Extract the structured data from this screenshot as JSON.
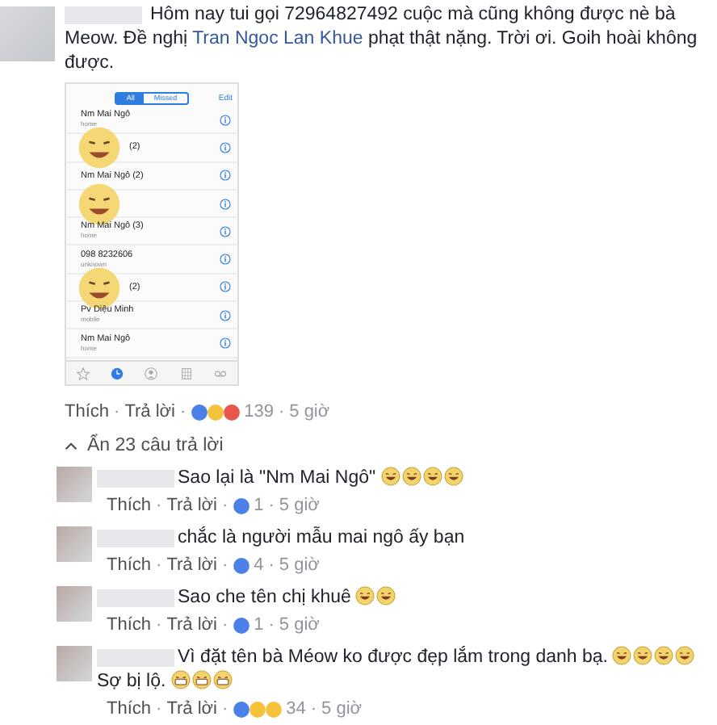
{
  "comment": {
    "text_before": "Hôm nay tui gọi 72964827492 cuộc mà cũng không được nè bà Meow. Đề nghị ",
    "link": "Tran Ngoc Lan Khue",
    "text_after": " phạt thật nặng. Trời ơi. Goih hoài không được.",
    "screenshot": {
      "tabs": [
        {
          "label": "All",
          "selected": true
        },
        {
          "label": "Missed",
          "selected": false
        }
      ],
      "edit": "Edit",
      "calls": [
        {
          "name": "Nm Mai Ngô",
          "sub": "home",
          "covered": false
        },
        {
          "name": "(2)",
          "covered": true
        },
        {
          "name": "Nm Mai Ngô (2)",
          "covered": false
        },
        {
          "covered": true
        },
        {
          "name": "Nm Mai Ngô (3)",
          "sub": "home",
          "covered": false
        },
        {
          "name": "098 8232606",
          "sub": "unknown",
          "covered": false
        },
        {
          "name": "(2)",
          "covered": true
        },
        {
          "name": "Pv Diệu Minh",
          "sub": "mobile",
          "covered": false
        },
        {
          "name": "Nm Mai Ngô",
          "sub": "home",
          "covered": false
        }
      ]
    },
    "actions": [
      {
        "kind": "like",
        "text": "Thích"
      },
      {
        "kind": "sep",
        "text": "·"
      },
      {
        "kind": "reply",
        "text": "Trả lời"
      },
      {
        "kind": "sep",
        "text": "·"
      },
      {
        "kind": "reactions",
        "reactions": [
          {
            "kind": "like"
          },
          {
            "kind": "haha"
          },
          {
            "kind": "angry"
          }
        ]
      },
      {
        "kind": "count",
        "text": "139"
      },
      {
        "kind": "sep",
        "text": "·"
      },
      {
        "kind": "time",
        "text": "5 giờ"
      }
    ]
  },
  "toggle": "Ẩn 23 câu trả lời",
  "replies": [
    {
      "parts": [
        {
          "kind": "text",
          "text": "Sao lại là \"Nm Mai Ngô\""
        },
        {
          "kind": "laugh"
        },
        {
          "kind": "laugh"
        },
        {
          "kind": "laugh"
        },
        {
          "kind": "laugh"
        }
      ],
      "actions": [
        {
          "kind": "like",
          "text": "Thích"
        },
        {
          "kind": "sep",
          "text": "·"
        },
        {
          "kind": "reply",
          "text": "Trả lời"
        },
        {
          "kind": "sep",
          "text": "·"
        },
        {
          "kind": "reactions",
          "reactions": [
            {
              "kind": "like"
            }
          ]
        },
        {
          "kind": "count",
          "text": "1"
        },
        {
          "kind": "sep",
          "text": "·"
        },
        {
          "kind": "time",
          "text": "5 giờ"
        }
      ]
    },
    {
      "parts": [
        {
          "kind": "text",
          "text": "chắc là người mẫu mai ngô ấy bạn"
        }
      ],
      "actions": [
        {
          "kind": "like",
          "text": "Thích"
        },
        {
          "kind": "sep",
          "text": "·"
        },
        {
          "kind": "reply",
          "text": "Trả lời"
        },
        {
          "kind": "sep",
          "text": "·"
        },
        {
          "kind": "reactions",
          "reactions": [
            {
              "kind": "like"
            }
          ]
        },
        {
          "kind": "count",
          "text": "4"
        },
        {
          "kind": "sep",
          "text": "·"
        },
        {
          "kind": "time",
          "text": "5 giờ"
        }
      ]
    },
    {
      "parts": [
        {
          "kind": "text",
          "text": "Sao che tên chị khuê"
        },
        {
          "kind": "laugh"
        },
        {
          "kind": "laugh"
        }
      ],
      "actions": [
        {
          "kind": "like",
          "text": "Thích"
        },
        {
          "kind": "sep",
          "text": "·"
        },
        {
          "kind": "reply",
          "text": "Trả lời"
        },
        {
          "kind": "sep",
          "text": "·"
        },
        {
          "kind": "reactions",
          "reactions": [
            {
              "kind": "like"
            }
          ]
        },
        {
          "kind": "count",
          "text": "1"
        },
        {
          "kind": "sep",
          "text": "·"
        },
        {
          "kind": "time",
          "text": "5 giờ"
        }
      ]
    },
    {
      "parts": [
        {
          "kind": "text",
          "text": "Vì đặt tên bà Méow ko được đẹp lắm trong danh bạ."
        },
        {
          "kind": "laugh"
        },
        {
          "kind": "laugh"
        },
        {
          "kind": "laugh"
        },
        {
          "kind": "laugh"
        },
        {
          "kind": "text",
          "text": "Sợ bị lộ."
        },
        {
          "kind": "scream"
        },
        {
          "kind": "scream"
        },
        {
          "kind": "scream"
        }
      ],
      "actions": [
        {
          "kind": "like",
          "text": "Thích"
        },
        {
          "kind": "sep",
          "text": "·"
        },
        {
          "kind": "reply",
          "text": "Trả lời"
        },
        {
          "kind": "sep",
          "text": "·"
        },
        {
          "kind": "reactions",
          "reactions": [
            {
              "kind": "like"
            },
            {
              "kind": "haha"
            },
            {
              "kind": "wow"
            }
          ]
        },
        {
          "kind": "count",
          "text": "34"
        },
        {
          "kind": "sep",
          "text": "·"
        },
        {
          "kind": "time",
          "text": "5 giờ"
        }
      ]
    }
  ]
}
